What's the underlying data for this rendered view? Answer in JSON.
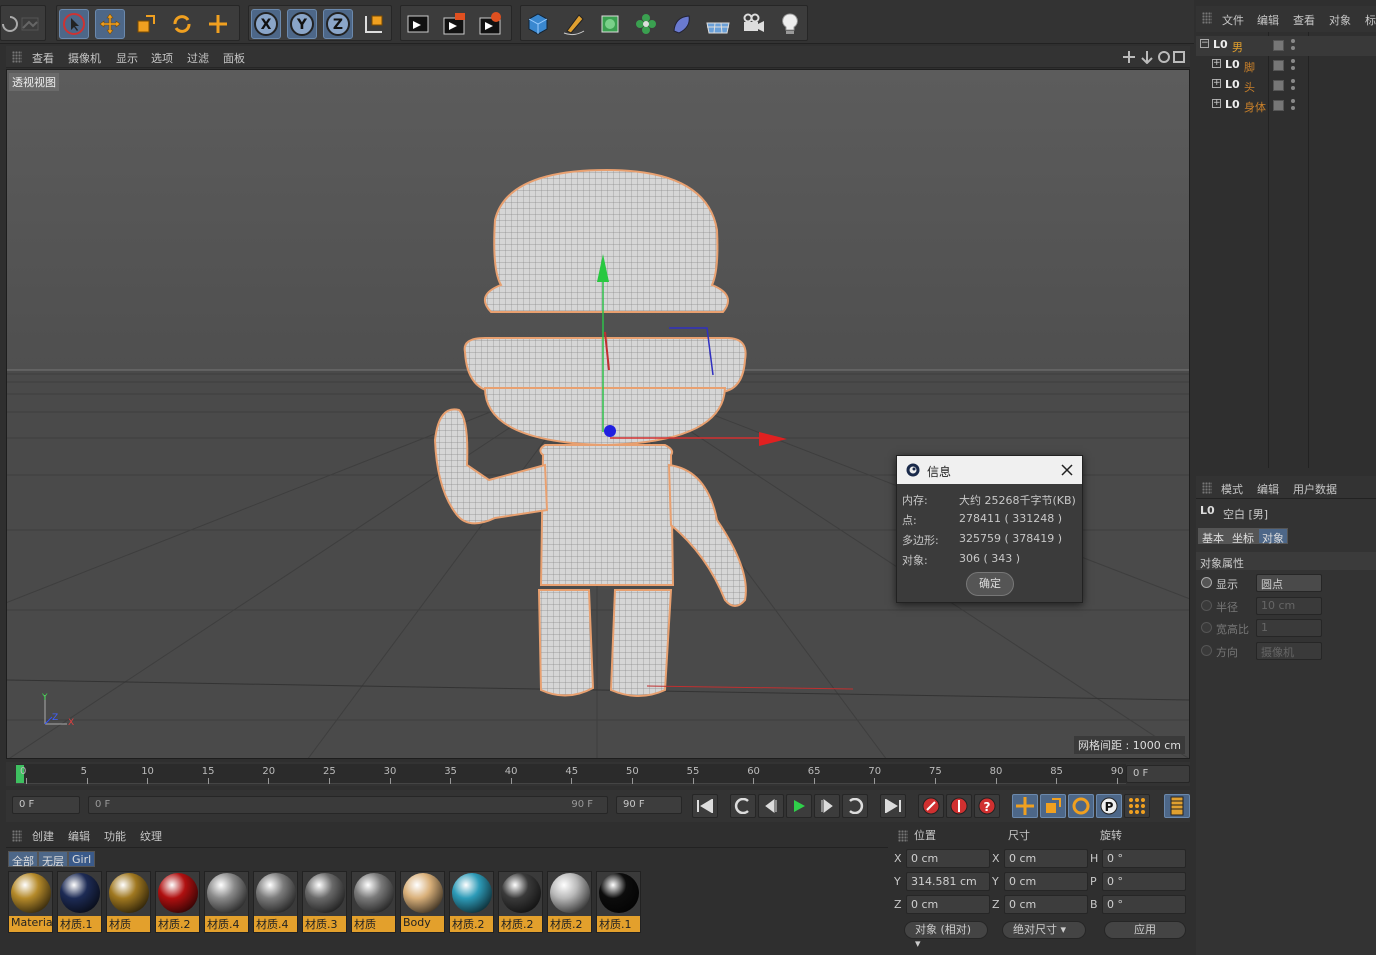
{
  "viewport": {
    "menu": [
      "查看",
      "摄像机",
      "显示",
      "选项",
      "过滤",
      "面板"
    ],
    "label": "透视视图",
    "grid_distance": "网格间距 : 1000 cm",
    "axis_x": "X",
    "axis_y": "Y",
    "axis_z": "Z"
  },
  "toolbar": {
    "icons": [
      "undo-icon",
      "redo-icon",
      "select-icon",
      "move-icon",
      "scale-icon",
      "rotate-icon",
      "live-select-icon",
      "x-axis-icon",
      "y-axis-icon",
      "z-axis-icon",
      "coord-system-icon",
      "render-view-icon",
      "render-picture-viewer-icon",
      "render-settings-icon",
      "cube-icon",
      "pen-icon",
      "subdivision-icon",
      "cloner-icon",
      "deformer-icon",
      "floor-icon",
      "camera-icon",
      "light-icon"
    ],
    "x_label": "X",
    "y_label": "Y",
    "z_label": "Z"
  },
  "timeline": {
    "ticks": [
      "0",
      "5",
      "10",
      "15",
      "20",
      "25",
      "30",
      "35",
      "40",
      "45",
      "50",
      "55",
      "60",
      "65",
      "70",
      "75",
      "80",
      "85",
      "90"
    ],
    "current_frame": "0 F",
    "start_field": "0 F",
    "range_start": "0 F",
    "range_end": "90 F",
    "end_field": "90 F"
  },
  "material_manager": {
    "menu": [
      "创建",
      "编辑",
      "功能",
      "纹理"
    ],
    "filters": [
      "全部",
      "无层",
      "Girl"
    ],
    "materials": [
      {
        "name": "Materia",
        "color": "#b58a2a"
      },
      {
        "name": "材质.1",
        "color": "#1d2b55"
      },
      {
        "name": "材质",
        "color": "#a07820"
      },
      {
        "name": "材质.2",
        "color": "#b01010"
      },
      {
        "name": "材质.4",
        "color": "#8a8a8a"
      },
      {
        "name": "材质.4",
        "color": "#7c7c7c"
      },
      {
        "name": "材质.3",
        "color": "#6a6a6a"
      },
      {
        "name": "材质",
        "color": "#7a7a7a"
      },
      {
        "name": "Body",
        "color": "#d9b07a"
      },
      {
        "name": "材质.2",
        "color": "#2d9bb8"
      },
      {
        "name": "材质.2",
        "color": "#3a3a3a"
      },
      {
        "name": "材质.2",
        "color": "#b8b8b8"
      },
      {
        "name": "材质.1",
        "color": "#0c0c0c"
      }
    ]
  },
  "coordinates": {
    "headers": [
      "位置",
      "尺寸",
      "旋转"
    ],
    "pos": [
      {
        "axis": "X",
        "value": "0 cm"
      },
      {
        "axis": "Y",
        "value": "314.581 cm"
      },
      {
        "axis": "Z",
        "value": "0 cm"
      }
    ],
    "size": [
      {
        "axis": "X",
        "value": "0 cm"
      },
      {
        "axis": "Y",
        "value": "0 cm"
      },
      {
        "axis": "Z",
        "value": "0 cm"
      }
    ],
    "rot": [
      {
        "axis": "H",
        "value": "0 °"
      },
      {
        "axis": "P",
        "value": "0 °"
      },
      {
        "axis": "B",
        "value": "0 °"
      }
    ],
    "mode_dropdown": "对象 (相对)",
    "size_dropdown": "绝对尺寸",
    "apply_button": "应用"
  },
  "object_manager": {
    "menu": [
      "文件",
      "编辑",
      "查看",
      "对象",
      "标"
    ],
    "items": [
      {
        "name": "男",
        "color": "#e3a02c"
      },
      {
        "name": "脚",
        "color": "#c9802a"
      },
      {
        "name": "头",
        "color": "#c9802a"
      },
      {
        "name": "身体",
        "color": "#c9802a"
      }
    ],
    "null_label": "L0"
  },
  "attributes": {
    "menu": [
      "模式",
      "编辑",
      "用户数据"
    ],
    "object_title": "空白 [男]",
    "tabs": [
      "基本",
      "坐标",
      "对象"
    ],
    "section": "对象属性",
    "rows": [
      {
        "label": "显示",
        "value": "圆点"
      },
      {
        "label": "半径",
        "value": "10 cm"
      },
      {
        "label": "宽高比",
        "value": "1"
      },
      {
        "label": "方向",
        "value": "摄像机"
      }
    ]
  },
  "info_dialog": {
    "title": "信息",
    "rows": [
      {
        "label": "内存:",
        "value": "大约 25268千字节(KB)"
      },
      {
        "label": "点:",
        "value": "278411 ( 331248 )"
      },
      {
        "label": "多边形:",
        "value": "325759 ( 378419 )"
      },
      {
        "label": "对象:",
        "value": "306 ( 343 )"
      }
    ],
    "ok": "确定"
  }
}
